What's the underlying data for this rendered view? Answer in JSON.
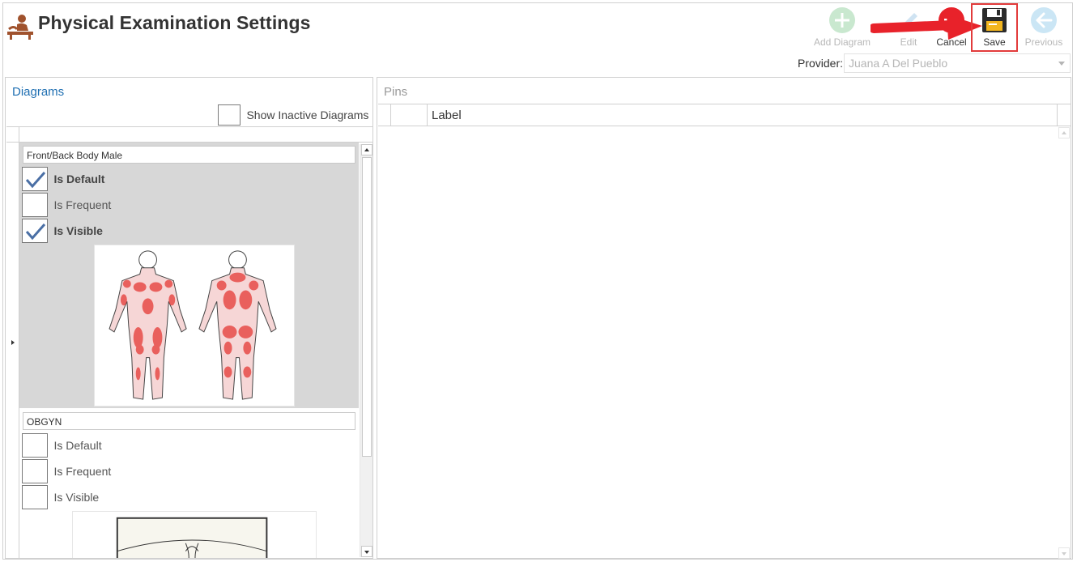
{
  "header": {
    "title": "Physical Examination Settings",
    "logo_icon": "massage-treatment-icon"
  },
  "toolbar": {
    "add_diagram": {
      "label": "Add Diagram",
      "icon": "plus-circle-icon",
      "enabled": false
    },
    "edit": {
      "label": "Edit",
      "icon": "pencil-icon",
      "enabled": false
    },
    "cancel": {
      "label": "Cancel",
      "icon": "cancel-circle-icon",
      "enabled": true
    },
    "save": {
      "label": "Save",
      "icon": "floppy-disk-icon",
      "enabled": true,
      "highlighted": true
    },
    "previous": {
      "label": "Previous",
      "icon": "arrow-left-circle-icon",
      "enabled": false
    }
  },
  "provider": {
    "label": "Provider:",
    "value": "Juana A Del Pueblo"
  },
  "diagrams": {
    "title": "Diagrams",
    "show_inactive": {
      "label": "Show Inactive Diagrams",
      "checked": false
    },
    "items": [
      {
        "name": "Front/Back Body Male",
        "selected": true,
        "is_default": {
          "label": "Is Default",
          "checked": true
        },
        "is_frequent": {
          "label": "Is Frequent",
          "checked": false
        },
        "is_visible": {
          "label": "Is Visible",
          "checked": true
        },
        "image": "front-back-body-male-muscles"
      },
      {
        "name": "OBGYN",
        "selected": false,
        "is_default": {
          "label": "Is Default",
          "checked": false
        },
        "is_frequent": {
          "label": "Is Frequent",
          "checked": false
        },
        "is_visible": {
          "label": "Is Visible",
          "checked": false
        },
        "image": "obgyn-diagram"
      }
    ]
  },
  "pins": {
    "title": "Pins",
    "columns": [
      "",
      "Label"
    ],
    "rows": []
  },
  "colors": {
    "accent": "#1f6fb2",
    "highlight": "#e23b3b",
    "selected_row": "#d7d7d7"
  }
}
